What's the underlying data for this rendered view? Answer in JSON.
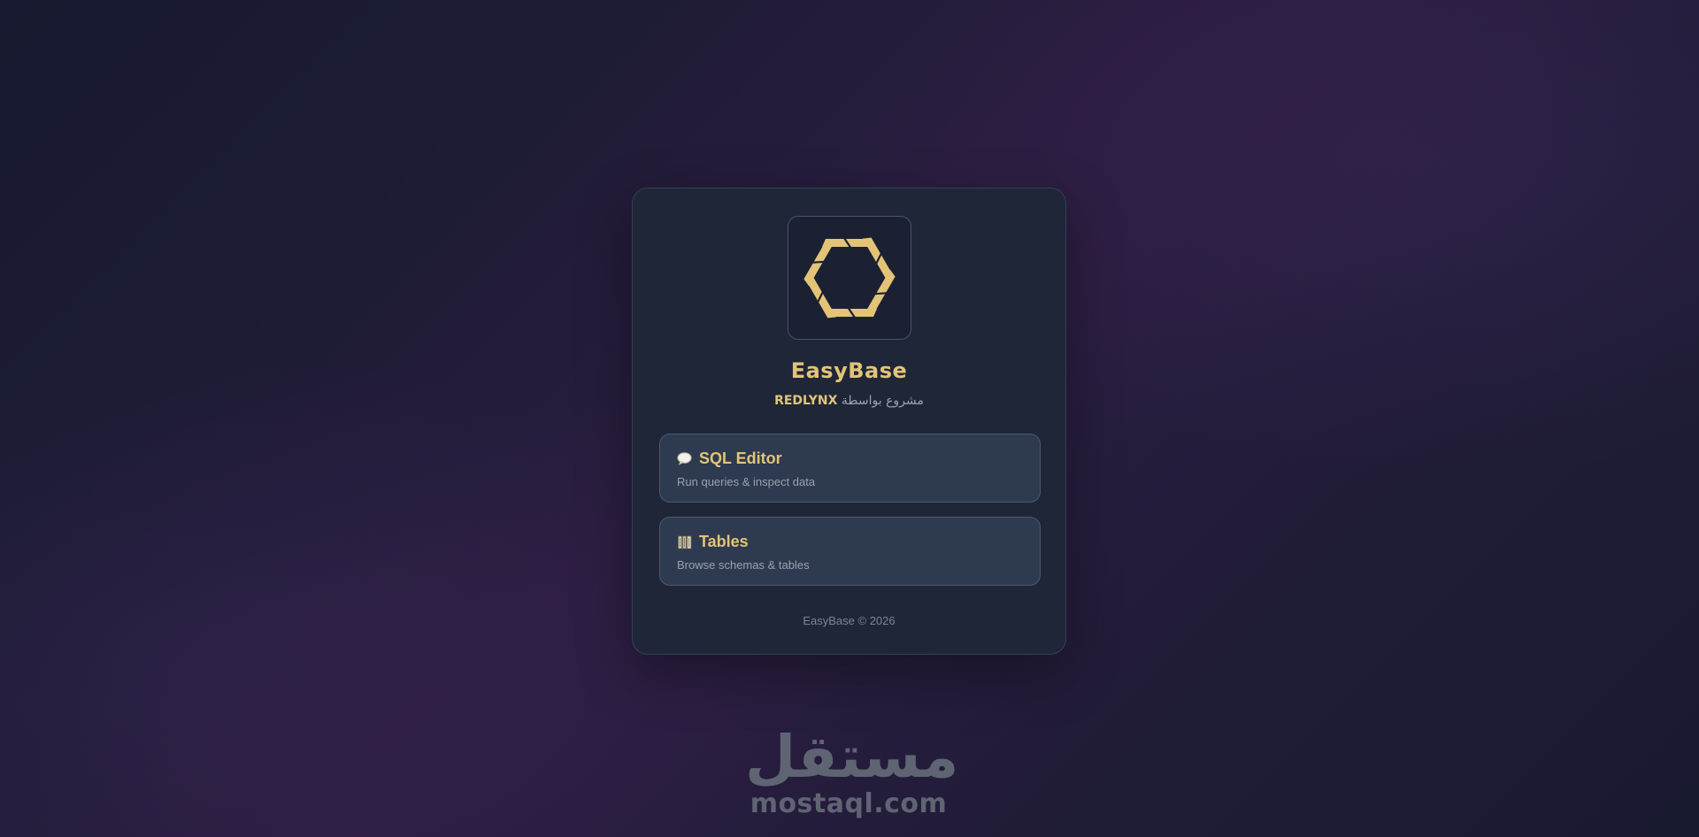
{
  "app": {
    "title": "EasyBase",
    "byline_prefix": "مشروع بواسطة",
    "byline_brand": "REDLYNX",
    "logo_icon": "hexagon-logo-icon",
    "accent_color": "#e3c477"
  },
  "tiles": [
    {
      "icon": "speech-bubble-icon",
      "title": "SQL Editor",
      "subtitle": "Run queries & inspect data"
    },
    {
      "icon": "books-icon",
      "title": "Tables",
      "subtitle": "Browse schemas & tables"
    }
  ],
  "footer": {
    "text": "EasyBase © 2026"
  },
  "watermark": {
    "arabic": "مستقل",
    "latin": "mostaql.com"
  }
}
